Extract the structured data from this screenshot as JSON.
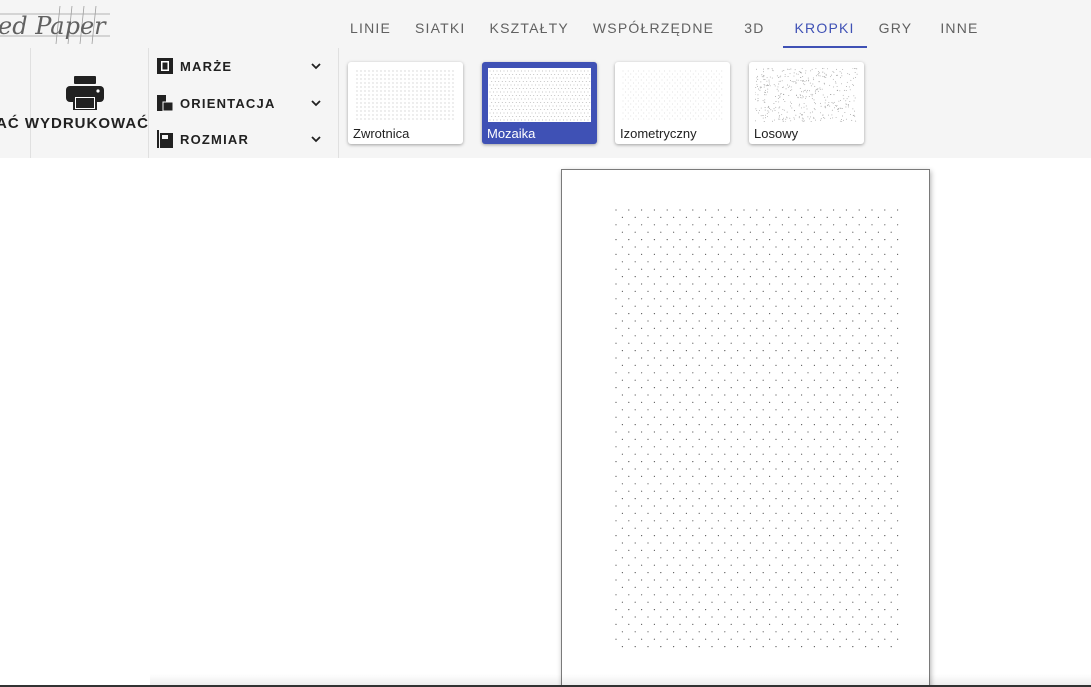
{
  "logo": {
    "text": "ed Paper"
  },
  "nav": {
    "tabs": [
      {
        "label": "LINIE",
        "active": false
      },
      {
        "label": "SIATKI",
        "active": false
      },
      {
        "label": "KSZTAŁTY",
        "active": false
      },
      {
        "label": "WSPÓŁRZĘDNE",
        "active": false
      },
      {
        "label": "3D",
        "active": false
      },
      {
        "label": "KROPKI",
        "active": true
      },
      {
        "label": "GRY",
        "active": false
      },
      {
        "label": "INNE",
        "active": false
      }
    ]
  },
  "toolbar": {
    "print_label": "AĆ WYDRUKOWAĆ",
    "print_icon": "printer-icon",
    "settings": [
      {
        "label": "MARŻE",
        "icon": "margins-icon"
      },
      {
        "label": "ORIENTACJA",
        "icon": "orientation-icon"
      },
      {
        "label": "ROZMIAR",
        "icon": "size-icon"
      }
    ]
  },
  "patterns": {
    "selected": "Mozaika",
    "items": [
      {
        "label": "Zwrotnica"
      },
      {
        "label": "Mozaika"
      },
      {
        "label": "Izometryczny"
      },
      {
        "label": "Losowy"
      }
    ]
  },
  "colors": {
    "accent": "#3f51b5",
    "toolbar_bg": "#f5f5f5",
    "text": "#212121",
    "tab_text": "#616161"
  }
}
